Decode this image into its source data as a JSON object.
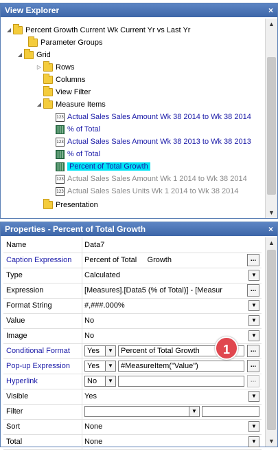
{
  "view_explorer": {
    "title": "View Explorer",
    "close_label": "×",
    "tree": [
      {
        "label": "Percent Growth Current Wk Current Yr vs Last Yr",
        "icon": "folder-icon",
        "style": "normal",
        "expander": "◢"
      },
      {
        "label": "Parameter Groups",
        "icon": "folder-icon",
        "style": "normal",
        "expander": ""
      },
      {
        "label": "Grid",
        "icon": "folder-icon",
        "style": "normal",
        "expander": "◢"
      },
      {
        "label": "Rows",
        "icon": "folder-icon",
        "style": "normal",
        "expander": "▷"
      },
      {
        "label": "Columns",
        "icon": "folder-icon",
        "style": "normal",
        "expander": ""
      },
      {
        "label": "View Filter",
        "icon": "folder-icon",
        "style": "normal",
        "expander": ""
      },
      {
        "label": "Measure Items",
        "icon": "folder-icon",
        "style": "normal",
        "expander": "◢"
      },
      {
        "label": "Actual Sales Sales Amount Wk 38 2014 to Wk 38 2014",
        "icon": "number-measure-icon",
        "style": "blue",
        "expander": ""
      },
      {
        "label": "% of Total",
        "icon": "calculated-measure-icon",
        "style": "blue",
        "expander": ""
      },
      {
        "label": "Actual Sales Sales Amount Wk 38 2013 to Wk 38 2013",
        "icon": "number-measure-icon",
        "style": "blue",
        "expander": ""
      },
      {
        "label": "% of Total",
        "icon": "calculated-measure-icon",
        "style": "blue",
        "expander": ""
      },
      {
        "label": "Percent of Total Growth",
        "icon": "calculated-measure-icon",
        "style": "selected",
        "expander": ""
      },
      {
        "label": "Actual Sales Sales Amount Wk 1 2014 to Wk 38 2014",
        "icon": "number-measure-icon",
        "style": "gray",
        "expander": ""
      },
      {
        "label": "Actual Sales Sales Units Wk 1 2014 to Wk 38 2014",
        "icon": "number-measure-icon",
        "style": "gray",
        "expander": ""
      },
      {
        "label": "Presentation",
        "icon": "folder-icon",
        "style": "normal",
        "expander": ""
      }
    ]
  },
  "properties": {
    "title": "Properties - Percent of Total Growth",
    "close_label": "×",
    "rows": [
      {
        "name": "Name",
        "value": "Data7"
      },
      {
        "name": "Caption Expression",
        "value": "Percent of Total     Growth",
        "ellipsis": "..."
      },
      {
        "name": "Type",
        "value": "Calculated"
      },
      {
        "name": "Expression",
        "value": "[Measures].[Data5 (% of Total)] - [Measur",
        "ellipsis": "..."
      },
      {
        "name": "Format String",
        "value": "#,###.000%"
      },
      {
        "name": "Value",
        "value": "No"
      },
      {
        "name": "Image",
        "value": "No"
      },
      {
        "name": "Conditional Format",
        "flag": "Yes",
        "value": "Percent of Total Growth",
        "ellipsis": "..."
      },
      {
        "name": "Pop-up Expression",
        "flag": "Yes",
        "value": "#MeasureItem(\"Value\")",
        "ellipsis": "..."
      },
      {
        "name": "Hyperlink",
        "flag": "No",
        "value": "",
        "ellipsis": "..."
      },
      {
        "name": "Visible",
        "value": "Yes"
      },
      {
        "name": "Filter",
        "value": "",
        "extra": ""
      },
      {
        "name": "Sort",
        "value": "None"
      },
      {
        "name": "Total",
        "value": "None"
      }
    ],
    "callout": "1"
  },
  "colors": {
    "title_bar": "#3d66a8",
    "selected_highlight": "#00e5f5",
    "link_blue": "#1a1aa8",
    "callout_red": "#e0474f"
  }
}
